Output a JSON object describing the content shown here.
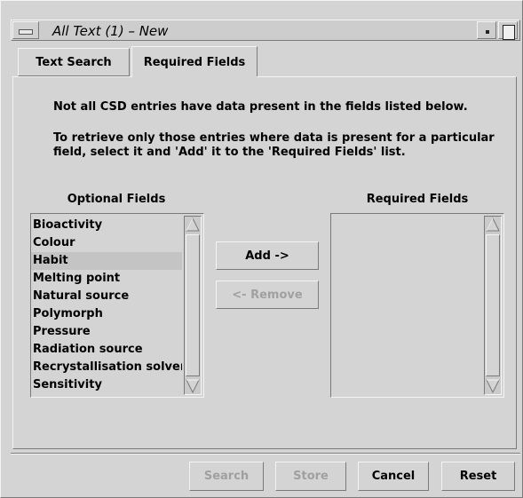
{
  "window": {
    "title": "All Text (1) – New"
  },
  "tabs": [
    {
      "label": "Text Search",
      "active": false
    },
    {
      "label": "Required Fields",
      "active": true
    }
  ],
  "content": {
    "info_line": "Not all CSD entries have data present in the fields listed below.",
    "instruction_line1": "To retrieve only those entries where data is present for a particular",
    "instruction_line2": "field, select it and 'Add' it to the 'Required Fields' list."
  },
  "optional_fields": {
    "heading": "Optional Fields",
    "items": [
      "Bioactivity",
      "Colour",
      "Habit",
      "Melting point",
      "Natural source",
      "Polymorph",
      "Pressure",
      "Radiation source",
      "Recrystallisation solven",
      "Sensitivity"
    ],
    "selected": "Habit"
  },
  "required_fields": {
    "heading": "Required Fields",
    "items": []
  },
  "transfer_buttons": {
    "add": "Add ->",
    "remove": "<- Remove"
  },
  "footer_buttons": {
    "search": "Search",
    "store": "Store",
    "cancel": "Cancel",
    "reset": "Reset"
  },
  "icons": {
    "window_menu": "window-menu-icon",
    "minimize": "minimize-icon",
    "maximize": "maximize-icon",
    "scroll_up": "up-arrow-icon",
    "scroll_down": "down-arrow-icon"
  }
}
